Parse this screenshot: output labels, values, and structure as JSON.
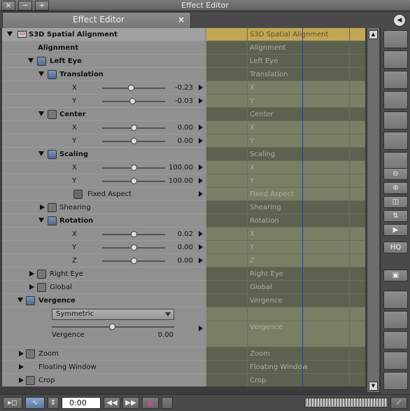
{
  "window": {
    "title": "Effect Editor",
    "close_glyph": "×",
    "minimize_glyph": "−",
    "plus_glyph": "+"
  },
  "tab": {
    "label": "Effect Editor",
    "close_glyph": "×",
    "menu_glyph": "◀"
  },
  "tree": {
    "effect": "S3D Spatial Alignment",
    "alignment": "Alignment",
    "left_eye": "Left Eye",
    "translation": "Translation",
    "translation_x": {
      "label": "X",
      "value": "-0.23"
    },
    "translation_y": {
      "label": "Y",
      "value": "-0.03"
    },
    "center": "Center",
    "center_x": {
      "label": "X",
      "value": "0.00"
    },
    "center_y": {
      "label": "Y",
      "value": "0.00"
    },
    "scaling": "Scaling",
    "scaling_x": {
      "label": "X",
      "value": "100.00"
    },
    "scaling_y": {
      "label": "Y",
      "value": "100.00"
    },
    "fixed_aspect": "Fixed Aspect",
    "shearing": "Shearing",
    "rotation": "Rotation",
    "rotation_x": {
      "label": "X",
      "value": "0.02"
    },
    "rotation_y": {
      "label": "Y",
      "value": "0.00"
    },
    "rotation_z": {
      "label": "Z",
      "value": "0.00"
    },
    "right_eye": "Right Eye",
    "global": "Global",
    "vergence": "Vergence",
    "vergence_mode": "Symmetric",
    "vergence_param": {
      "label": "Vergence",
      "value": "0.00"
    },
    "zoom": "Zoom",
    "floating_window": "Floating Window",
    "crop": "Crop"
  },
  "timeline": {
    "effect": "S3D Spatial Alignment",
    "alignment": "Alignment",
    "left_eye": "Left Eye",
    "translation": "Translation",
    "x": "X",
    "y": "Y",
    "z": "Z",
    "center": "Center",
    "scaling": "Scaling",
    "fixed_aspect": "Fixed Aspect",
    "shearing": "Shearing",
    "rotation": "Rotation",
    "right_eye": "Right Eye",
    "global": "Global",
    "vergence": "Vergence",
    "zoom": "Zoom",
    "floating_window": "Floating Window",
    "crop": "Crop"
  },
  "bottom": {
    "timecode": "0:00",
    "hq_label": "HQ"
  },
  "colors": {
    "gold_track": "#c1a654",
    "track": "#7a7e65",
    "track_dark": "#5d6150",
    "playhead": "#2b36c8",
    "checkbox_on": "#5a7aa8"
  }
}
